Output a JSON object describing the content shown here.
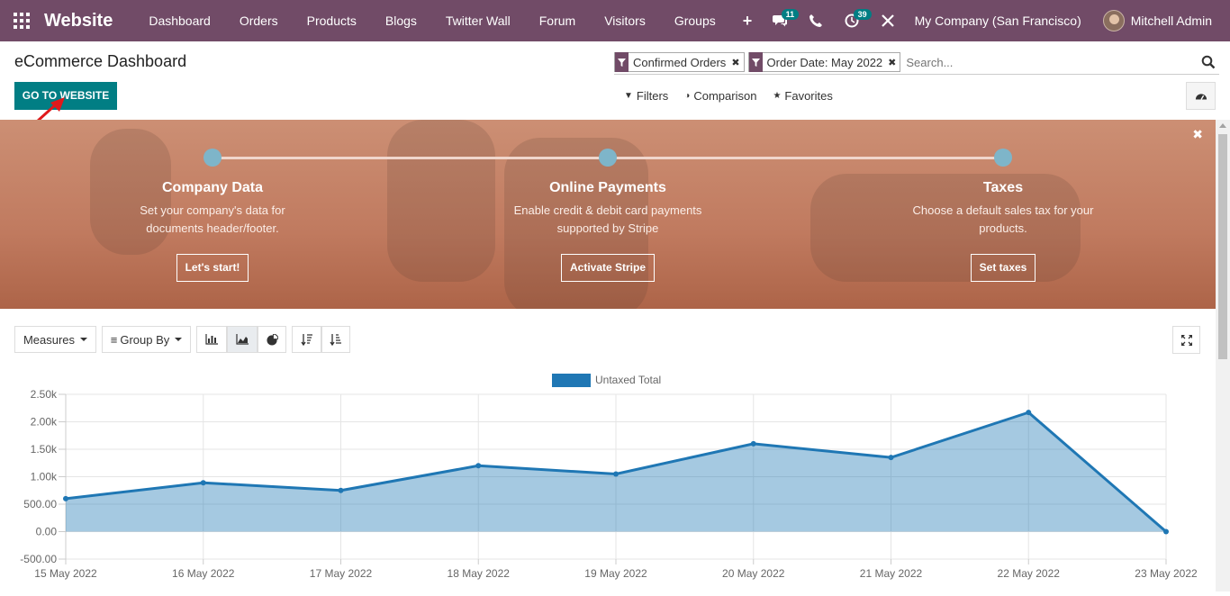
{
  "navbar": {
    "brand": "Website",
    "menu": [
      "Dashboard",
      "Orders",
      "Products",
      "Blogs",
      "Twitter Wall",
      "Forum",
      "Visitors",
      "Groups"
    ],
    "plus": "+",
    "messages_badge": "11",
    "activities_badge": "39",
    "company": "My Company (San Francisco)",
    "user": "Mitchell Admin"
  },
  "control": {
    "title": "eCommerce Dashboard",
    "goto_website": "GO TO WEBSITE",
    "facets": [
      "Confirmed Orders",
      "Order Date: May 2022"
    ],
    "search_placeholder": "Search...",
    "filters": "Filters",
    "comparison": "Comparison",
    "favorites": "Favorites"
  },
  "banner": {
    "steps": [
      {
        "title": "Company Data",
        "desc1": "Set your company's data for",
        "desc2": "documents header/footer.",
        "button": "Let's start!"
      },
      {
        "title": "Online Payments",
        "desc1": "Enable credit & debit card payments",
        "desc2": "supported by Stripe",
        "button": "Activate Stripe"
      },
      {
        "title": "Taxes",
        "desc1": "Choose a default sales tax for your",
        "desc2": "products.",
        "button": "Set taxes"
      }
    ]
  },
  "toolbar": {
    "measures": "Measures",
    "group_by": "Group By"
  },
  "colors": {
    "navbar": "#714b67",
    "primary": "#017e84",
    "series": "#1f77b4"
  },
  "chart_data": {
    "type": "area",
    "x": [
      "15 May 2022",
      "16 May 2022",
      "17 May 2022",
      "18 May 2022",
      "19 May 2022",
      "20 May 2022",
      "21 May 2022",
      "22 May 2022",
      "23 May 2022"
    ],
    "series": [
      {
        "name": "Untaxed Total",
        "values": [
          600,
          890,
          750,
          1200,
          1050,
          1600,
          1350,
          2170,
          0
        ]
      }
    ],
    "yticks": [
      "2.50k",
      "2.00k",
      "1.50k",
      "1.00k",
      "500.00",
      "0.00",
      "-500.00"
    ],
    "ylim": [
      -500,
      2500
    ],
    "grid": true,
    "legend": "top-center"
  }
}
